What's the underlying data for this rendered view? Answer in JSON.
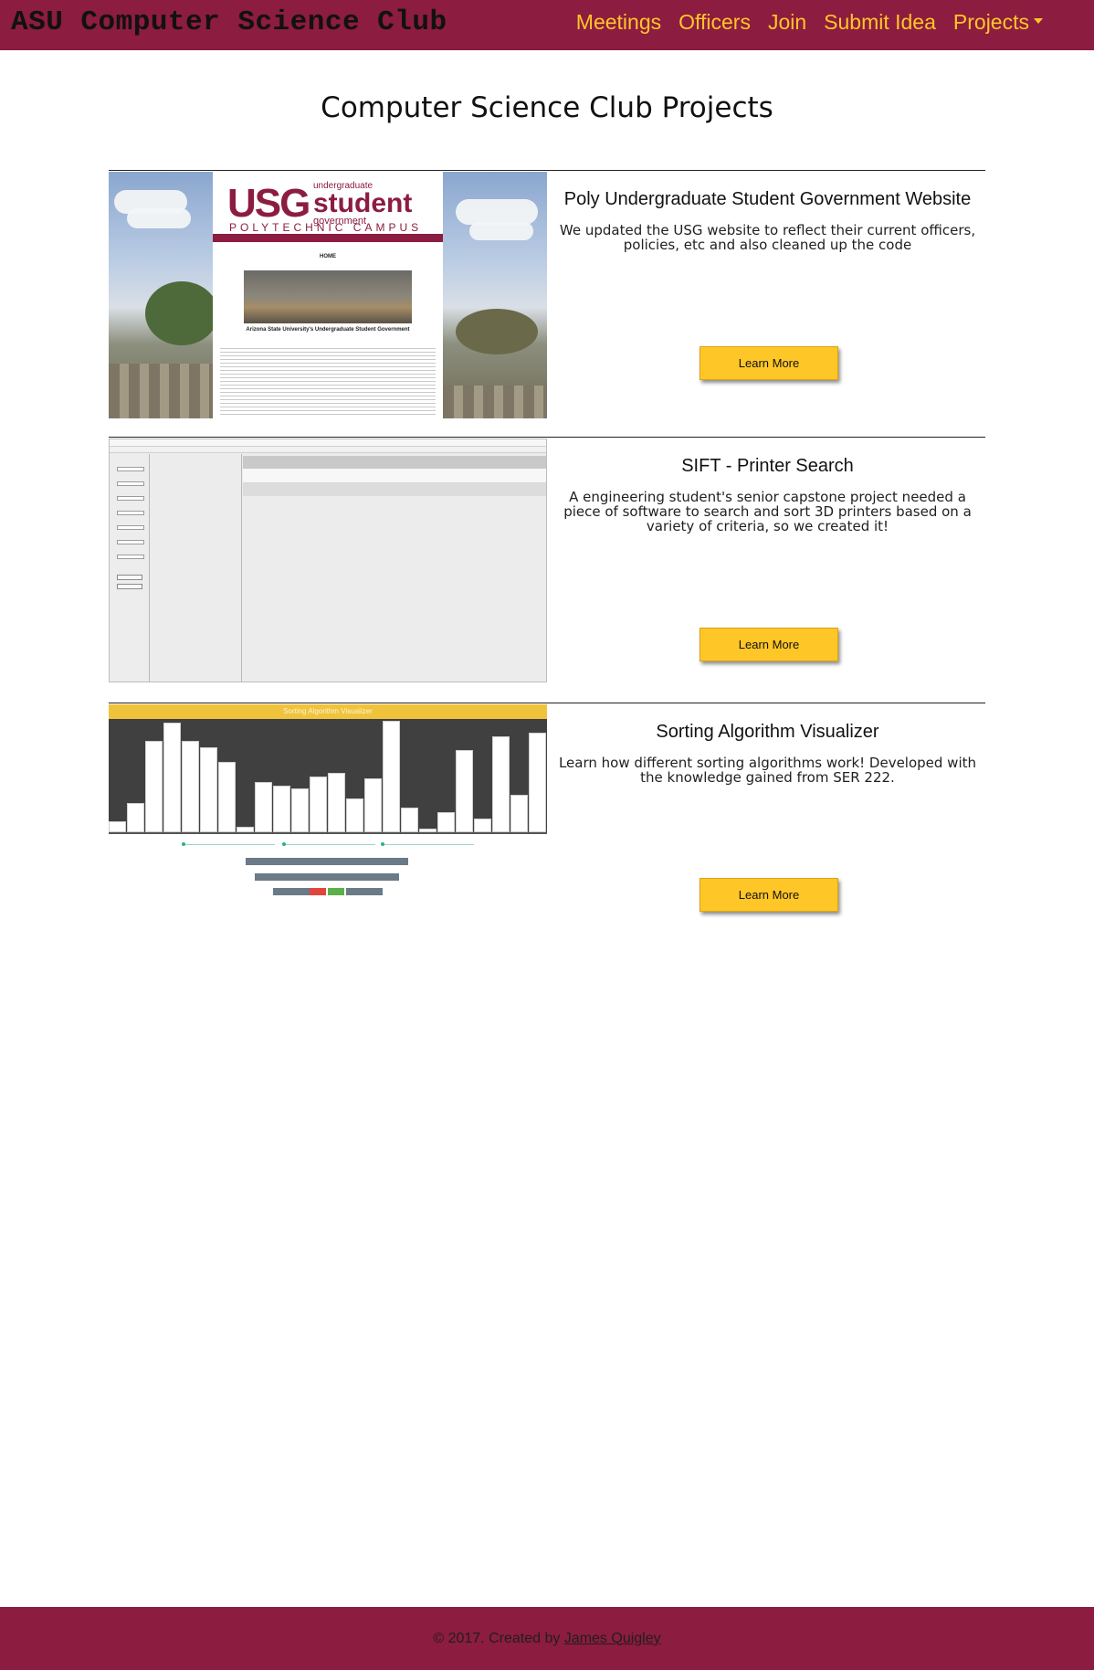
{
  "navbar": {
    "brand": "ASU Computer Science Club",
    "links": [
      "Meetings",
      "Officers",
      "Join",
      "Submit Idea",
      "Projects"
    ]
  },
  "page": {
    "title": "Computer Science Club Projects"
  },
  "projects": [
    {
      "title": "Poly Undergraduate Student Government Website",
      "description": "We updated the USG website to reflect their current officers, policies, etc and also cleaned up the code",
      "button": "Learn More",
      "thumb": {
        "logo_main": "USG",
        "logo_small_top": "undergraduate",
        "logo_student": "student",
        "logo_small_bottom": "government",
        "campus": "POLYTECHNIC CAMPUS",
        "heading": "HOME",
        "caption": "Arizona State University's Undergraduate Student Government"
      }
    },
    {
      "title": "SIFT - Printer Search",
      "description": "A engineering student's senior capstone project needed a piece of software to search and sort 3D printers based on a variety of criteria, so we created it!",
      "button": "Learn More"
    },
    {
      "title": "Sorting Algorithm Visualizer",
      "description": "Learn how different sorting algorithms work! Developed with the knowledge gained from SER 222.",
      "button": "Learn More",
      "thumb": {
        "header": "Sorting Algorithm Visualizer",
        "bar_values": [
          0.1,
          0.26,
          0.82,
          0.98,
          0.82,
          0.76,
          0.63,
          0.05,
          0.45,
          0.42,
          0.39,
          0.5,
          0.53,
          0.3,
          0.48,
          1.0,
          0.22,
          0.03,
          0.18,
          0.74,
          0.12,
          0.86,
          0.34,
          0.89
        ]
      }
    }
  ],
  "footer": {
    "text": "© 2017. Created by ",
    "link": "James Quigley"
  },
  "colors": {
    "maroon": "#8c1c40",
    "gold": "#ffc627"
  }
}
